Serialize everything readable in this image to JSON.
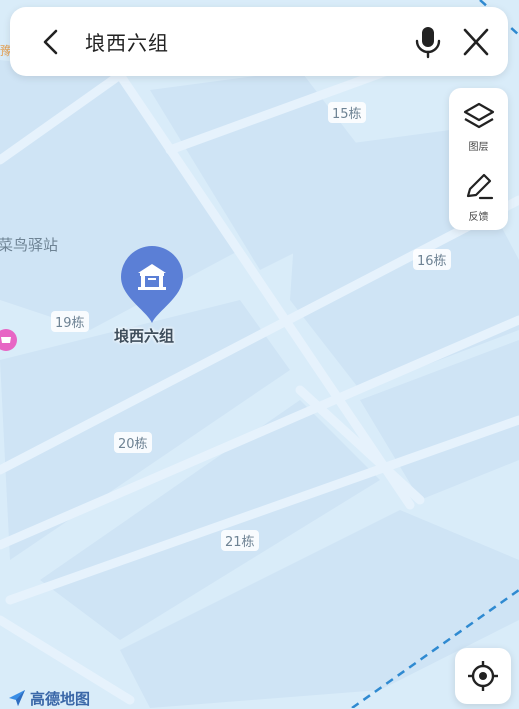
{
  "search": {
    "query": "埌西六组"
  },
  "tools": {
    "layers_label": "图层",
    "feedback_label": "反馈"
  },
  "map": {
    "poi_label": "埌西六组",
    "place_label": "菜鸟驿站",
    "edge_label": "豫",
    "buildings": [
      "15栋",
      "16栋",
      "19栋",
      "20栋",
      "21栋"
    ]
  },
  "logo": {
    "text": "高德地图"
  },
  "colors": {
    "map_bg": "#d9ecf9",
    "block": "#cfe4f5",
    "road": "#e6f2fc",
    "pin": "#5b7fd6",
    "boundary": "#2f8ad1"
  },
  "icons": {
    "back": "chevron-left-icon",
    "mic": "microphone-icon",
    "close": "close-icon",
    "layers": "layers-icon",
    "feedback": "pencil-icon",
    "locate": "crosshair-icon",
    "poi": "house-pin-icon"
  }
}
